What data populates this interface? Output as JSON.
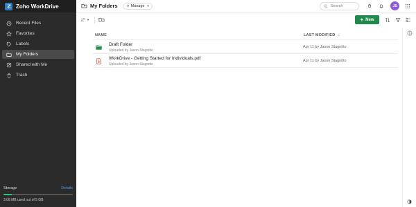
{
  "app": {
    "name": "Zoho WorkDrive"
  },
  "sidebar": {
    "items": [
      {
        "label": "Recent Files",
        "icon": "clock-icon"
      },
      {
        "label": "Favorites",
        "icon": "star-icon"
      },
      {
        "label": "Labels",
        "icon": "tag-icon"
      },
      {
        "label": "My Folders",
        "icon": "folder-icon",
        "active": true
      },
      {
        "label": "Shared with Me",
        "icon": "shared-icon"
      },
      {
        "label": "Trash",
        "icon": "trash-icon"
      }
    ],
    "storage": {
      "label": "Storage",
      "details_label": "Details",
      "usage_text": "3.08 MB used out of 5 GB",
      "used_fraction": 0.12
    }
  },
  "header": {
    "title": "My Folders",
    "manage_label": "Manage",
    "search_placeholder": "Search",
    "avatar_initials": "JS"
  },
  "toolbar": {
    "new_label": "New"
  },
  "table": {
    "columns": {
      "name": "NAME",
      "modified": "LAST MODIFIED"
    },
    "rows": [
      {
        "title": "Draft Folder",
        "subtitle": "Uploaded by Jason Stagnitto",
        "modified": "Apr 11 by Jason Stagnitto",
        "icon": "folder-icon"
      },
      {
        "title": "WorkDrive - Getting Started for Individuals.pdf",
        "subtitle": "Uploaded by Jason Stagnitto",
        "modified": "Apr 11 by Jason Stagnitto",
        "icon": "pdf-icon"
      }
    ]
  },
  "colors": {
    "sidebar_bg": "#2b2b2b",
    "accent_green": "#1f8a4c",
    "avatar_purple": "#8e5bd6",
    "link_blue": "#4a9ae0",
    "storage_green": "#2ec27e"
  }
}
